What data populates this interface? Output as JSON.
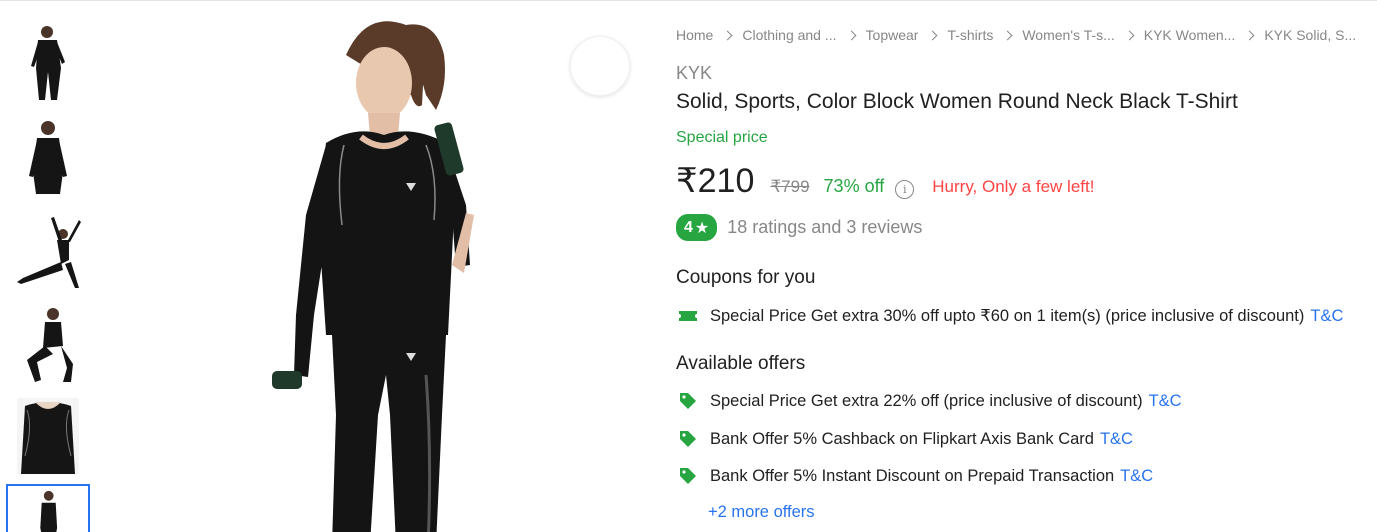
{
  "breadcrumb": [
    "Home",
    "Clothing and ...",
    "Topwear",
    "T-shirts",
    "Women's T-s...",
    "KYK Women...",
    "KYK Solid, S..."
  ],
  "product": {
    "brand": "KYK",
    "title": "Solid, Sports, Color Block Women Round Neck Black T-Shirt",
    "special_label": "Special price",
    "price": "₹210",
    "mrp": "₹799",
    "discount": "73% off",
    "info_glyph": "i",
    "stock_note": "Hurry, Only a few left!",
    "rating": "4",
    "rating_star": "★",
    "rating_summary": "18 ratings and 3 reviews"
  },
  "coupons": {
    "heading": "Coupons for you",
    "items": [
      {
        "text": "Special Price Get extra 30% off upto ₹60 on 1 item(s) (price inclusive of discount)",
        "link": "T&C",
        "icon": "ticket-icon"
      }
    ]
  },
  "offers": {
    "heading": "Available offers",
    "items": [
      {
        "text": "Special Price Get extra 22% off (price inclusive of discount)",
        "link": "T&C",
        "icon": "tag-icon"
      },
      {
        "text": "Bank Offer 5% Cashback on Flipkart Axis Bank Card",
        "link": "T&C",
        "icon": "tag-icon"
      },
      {
        "text": "Bank Offer 5% Instant Discount on Prepaid Transaction",
        "link": "T&C",
        "icon": "tag-icon"
      }
    ],
    "more": "+2 more offers"
  },
  "colors": {
    "green": "#26a541",
    "blue": "#2874f0",
    "red": "#ff4343",
    "grey": "#878787"
  }
}
